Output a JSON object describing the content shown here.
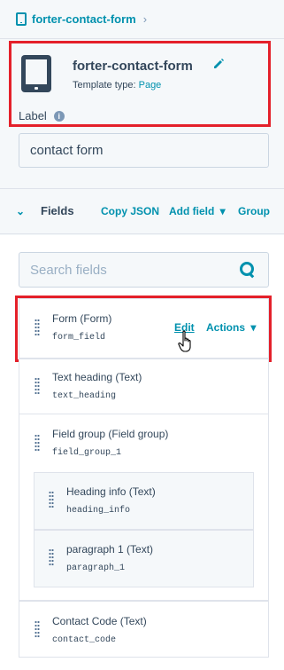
{
  "breadcrumb": {
    "module_name": "forter-contact-form",
    "chevron": "›"
  },
  "header": {
    "title": "forter-contact-form",
    "template_type_label": "Template type:",
    "template_type_value": "Page",
    "edit_icon": "pencil-icon"
  },
  "label_section": {
    "label": "Label",
    "info_glyph": "i",
    "value": "contact form"
  },
  "fields_bar": {
    "caret": "⌄",
    "title": "Fields",
    "copy_json": "Copy JSON",
    "add_field": "Add field",
    "add_field_caret": "▾",
    "group": "Group"
  },
  "search": {
    "placeholder": "Search fields"
  },
  "fields": [
    {
      "name": "Form (Form)",
      "key": "form_field",
      "edit": "Edit",
      "actions": "Actions",
      "actions_caret": "▾"
    },
    {
      "name": "Text heading (Text)",
      "key": "text_heading"
    },
    {
      "name": "Field group (Field group)",
      "key": "field_group_1",
      "children": [
        {
          "name": "Heading info (Text)",
          "key": "heading_info"
        },
        {
          "name": "paragraph 1 (Text)",
          "key": "paragraph_1"
        }
      ]
    },
    {
      "name": "Contact Code (Text)",
      "key": "contact_code"
    }
  ],
  "colors": {
    "accent": "#0091ae",
    "text": "#33475b",
    "highlight": "#e4202a"
  }
}
